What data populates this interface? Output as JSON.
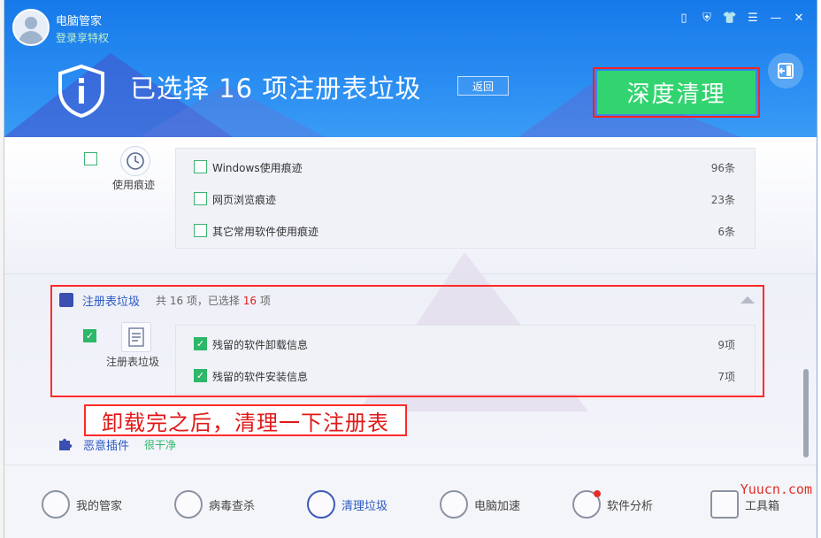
{
  "app": {
    "title": "电脑管家",
    "login_link": "登录享特权"
  },
  "titlebar": {
    "icons": [
      "phone-icon",
      "shield-lock-icon",
      "skin-icon",
      "menu-icon",
      "minimize-icon",
      "close-icon"
    ],
    "glyphs": [
      "▯",
      "⛨",
      "👕",
      "☰",
      "—",
      "✕"
    ]
  },
  "header": {
    "status_title": "已选择 16 项注册表垃圾",
    "back_button": "返回",
    "deep_clean_button": "深度清理"
  },
  "sections": {
    "usage": {
      "label": "使用痕迹",
      "checked": false,
      "items": [
        {
          "label": "Windows使用痕迹",
          "count": "96条",
          "checked": false
        },
        {
          "label": "网页浏览痕迹",
          "count": "23条",
          "checked": false
        },
        {
          "label": "其它常用软件使用痕迹",
          "count": "6条",
          "checked": false
        }
      ]
    },
    "registry": {
      "title": "注册表垃圾",
      "summary_prefix": "共 16 项，已选择 ",
      "summary_selected": "16",
      "summary_suffix": " 项",
      "label": "注册表垃圾",
      "checked": true,
      "items": [
        {
          "label": "残留的软件卸载信息",
          "count": "9项",
          "checked": true
        },
        {
          "label": "残留的软件安装信息",
          "count": "7项",
          "checked": true
        }
      ]
    },
    "plugins": {
      "title": "恶意插件",
      "status": "很干净"
    }
  },
  "annotation": "卸载完之后，清理一下注册表",
  "bottom_nav": [
    {
      "label": "我的管家",
      "icon": "user-icon",
      "active": false,
      "badge": false
    },
    {
      "label": "病毒查杀",
      "icon": "virus-scan-icon",
      "active": false,
      "badge": false
    },
    {
      "label": "清理垃圾",
      "icon": "broom-icon",
      "active": true,
      "badge": false
    },
    {
      "label": "电脑加速",
      "icon": "rocket-icon",
      "active": false,
      "badge": false
    },
    {
      "label": "软件分析",
      "icon": "analysis-icon",
      "active": false,
      "badge": true
    },
    {
      "label": "工具箱",
      "icon": "toolbox-icon",
      "active": false,
      "badge": false
    }
  ],
  "watermark": "Yuucn.com",
  "colors": {
    "header_blue": "#1679e9",
    "accent_green": "#32d46f",
    "highlight_red": "#ff2a2a",
    "link_blue": "#2b59c3"
  }
}
